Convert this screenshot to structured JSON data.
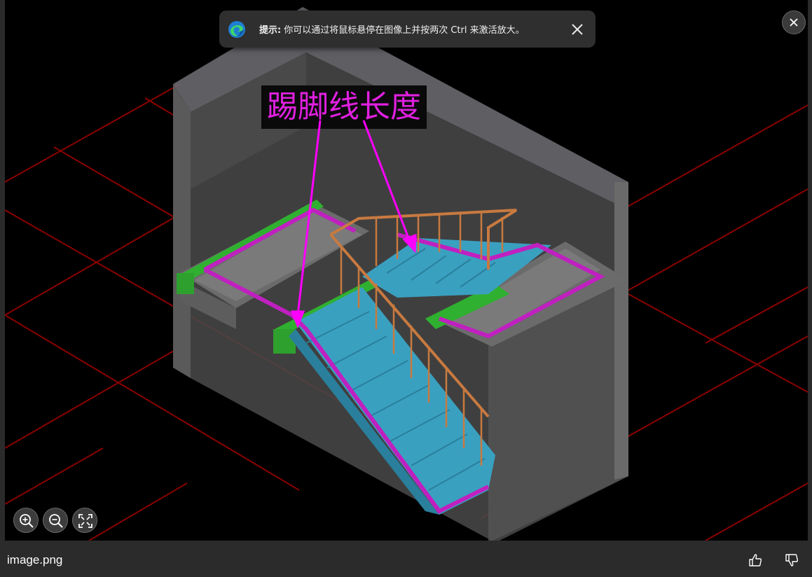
{
  "tip": {
    "prefix": "提示:",
    "message": "你可以通过将鼠标悬停在图像上并按两次 Ctrl 来激活放大。"
  },
  "image": {
    "annotation": "踢脚线长度",
    "colors": {
      "grid": "#8b0000",
      "wall": "#7a7a7a",
      "stair": "#3aa0c0",
      "skirting": "#c020c0",
      "rail": "#c87a40",
      "beam": "#30b030",
      "arrow": "#ff00ff"
    }
  },
  "footer": {
    "filename": "image.png"
  },
  "icons": {
    "edge": "edge-logo-icon",
    "close": "close-icon",
    "zoom_in": "zoom-in-icon",
    "zoom_out": "zoom-out-icon",
    "fit": "fit-screen-icon",
    "like": "thumbs-up-icon",
    "dislike": "thumbs-down-icon"
  }
}
